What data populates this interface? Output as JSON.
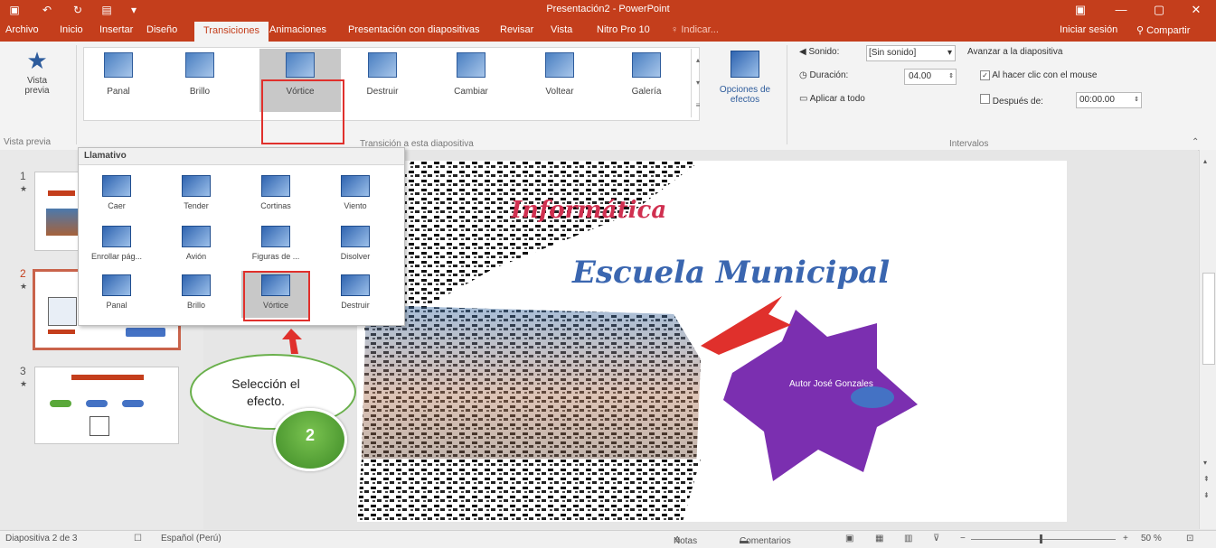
{
  "window": {
    "title": "Presentación2 - PowerPoint"
  },
  "tabs": [
    "Archivo",
    "Inicio",
    "Insertar",
    "Diseño",
    "Transiciones",
    "Animaciones",
    "Presentación con diapositivas",
    "Revisar",
    "Vista",
    "Nitro Pro 10",
    "Indicar...",
    "Iniciar sesión",
    "Compartir"
  ],
  "active_tab": "Transiciones",
  "ribbon": {
    "preview": {
      "label": "Vista previa",
      "group": "Vista previa"
    },
    "gallery": [
      "Panal",
      "Brillo",
      "Vórtice",
      "Destruir",
      "Cambiar",
      "Voltear",
      "Galería"
    ],
    "gallery_group": "Transición a esta diapositiva",
    "effect_options": "Opciones de efectos",
    "timing": {
      "sound_label": "Sonido:",
      "sound_value": "[Sin sonido]",
      "duration_label": "Duración:",
      "duration_value": "04.00",
      "apply_all": "Aplicar a todo",
      "advance_label": "Avanzar a la diapositiva",
      "on_click": "Al hacer clic con el mouse",
      "after_label": "Después de:",
      "after_value": "00:00.00",
      "group": "Intervalos"
    }
  },
  "dropdown": {
    "heading": "Llamativo",
    "items": [
      "Caer",
      "Tender",
      "Cortinas",
      "Viento",
      "Enrollar pág...",
      "Avión",
      "Figuras de ...",
      "Disolver",
      "Panal",
      "Brillo",
      "Vórtice",
      "Destruir"
    ],
    "selected": "Vórtice"
  },
  "slides": [
    "1",
    "2",
    "3"
  ],
  "slide": {
    "title_partial": "Informática",
    "subtitle": "Escuela Municipal",
    "author": "Autor José Gonzales"
  },
  "callout": {
    "text": "Selección el efecto.",
    "step": "2"
  },
  "status": {
    "slide_info": "Diapositiva 2 de 3",
    "language": "Español (Perú)",
    "notes": "Notas",
    "comments": "Comentarios",
    "zoom": "50 %"
  },
  "colors": {
    "accent": "#c43e1c",
    "highlight": "#e0302c",
    "star": "#7b2fb0",
    "callout_badge": "#5aa83a"
  }
}
